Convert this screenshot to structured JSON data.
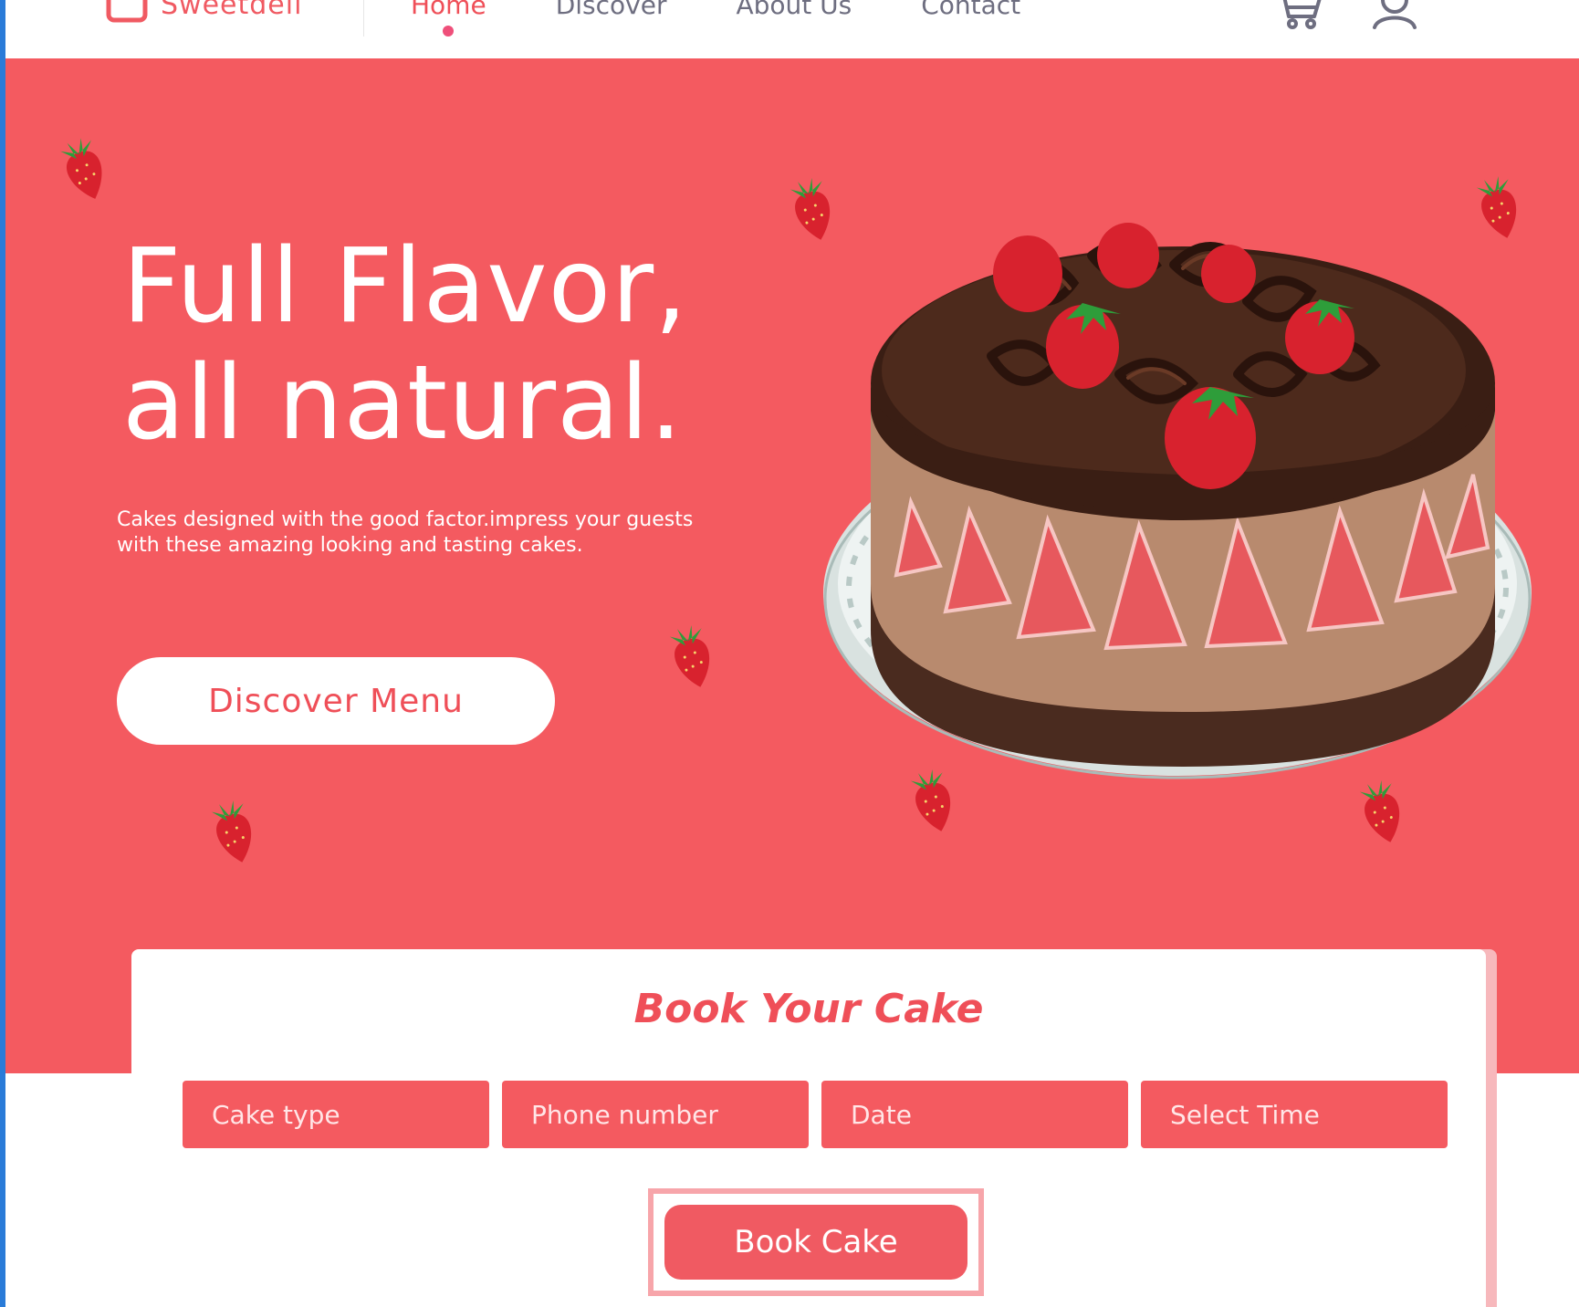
{
  "brand": {
    "name": "Sweetdeli",
    "logo_icon": "cake-box-icon"
  },
  "nav": {
    "links": [
      {
        "label": "Home",
        "active": true
      },
      {
        "label": "Discover",
        "active": false
      },
      {
        "label": "About Us",
        "active": false
      },
      {
        "label": "Contact",
        "active": false
      }
    ],
    "icons": [
      "cart-icon",
      "user-icon"
    ]
  },
  "hero": {
    "title_line1": "Full Flavor,",
    "title_line2": "all natural.",
    "description": "Cakes designed with the good factor.impress your guests with these amazing looking and tasting cakes.",
    "cta_label": "Discover Menu",
    "image": "chocolate-strawberry-cake",
    "decoration": "strawberry-icon"
  },
  "booking": {
    "title": "Book Your Cake",
    "fields": [
      {
        "placeholder": "Cake type",
        "value": ""
      },
      {
        "placeholder": "Phone number",
        "value": ""
      },
      {
        "placeholder": "Date",
        "value": ""
      },
      {
        "placeholder": "Select Time",
        "value": ""
      }
    ],
    "submit_label": "Book Cake"
  },
  "colors": {
    "primary": "#f45a60",
    "accent_text": "#ef4f58",
    "nav_text": "#6e6e80",
    "active_dot": "#ef4f7a",
    "white": "#ffffff"
  }
}
